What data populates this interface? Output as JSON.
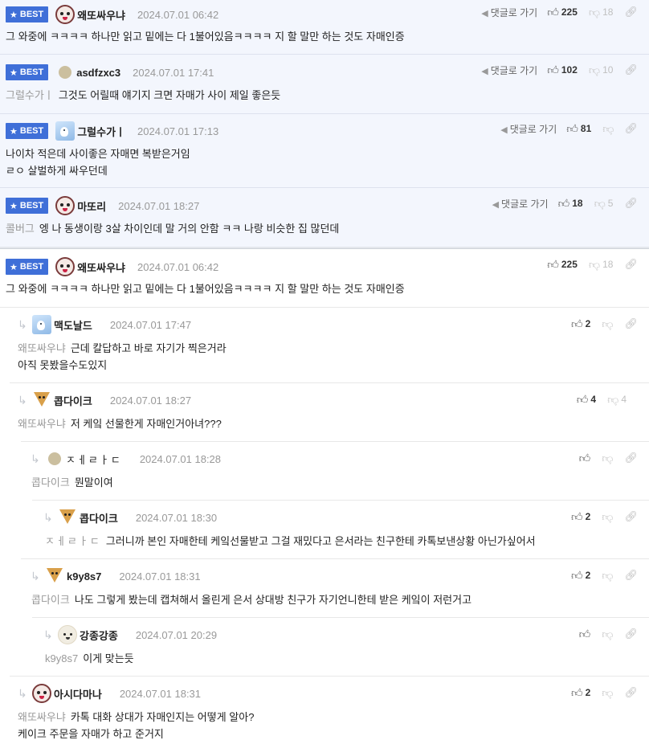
{
  "best_comments": [
    {
      "nick": "왜또싸우냐",
      "date": "2024.07.01 06:42",
      "goto": "댓글로 가기",
      "up": "225",
      "down": "18",
      "lines": [
        "그 와중에 ㅋㅋㅋㅋ 하나만 읽고 밑에는 다 1불어있음ㅋㅋㅋㅋ 지 할 말만 하는 것도 자매인증"
      ]
    },
    {
      "nick": "asdfzxc3",
      "date": "2024.07.01 17:41",
      "goto": "댓글로 가기",
      "up": "102",
      "down": "10",
      "mention": "그럴수가ㅣ",
      "lines": [
        "그것도 어릴때 얘기지 크면 자매가 사이 제일 좋은듯"
      ]
    },
    {
      "nick": "그럴수가ㅣ",
      "date": "2024.07.01 17:13",
      "goto": "댓글로 가기",
      "up": "81",
      "lines": [
        "나이차 적은데 사이좋은 자매면 복받은거임",
        "ㄹㅇ 살벌하게 싸우던데"
      ]
    },
    {
      "nick": "마또리",
      "date": "2024.07.01 18:27",
      "goto": "댓글로 가기",
      "up": "18",
      "down": "5",
      "mention": "콜버그",
      "lines": [
        "엥 나 동생이랑 3살 차이인데 말 거의 안함 ㅋㅋ 나랑 비슷한 집 많던데"
      ]
    }
  ],
  "best_label": "BEST",
  "thread_root": {
    "nick": "왜또싸우냐",
    "date": "2024.07.01 06:42",
    "up": "225",
    "down": "18",
    "lines": [
      "그 와중에 ㅋㅋㅋㅋ 하나만 읽고 밑에는 다 1불어있음ㅋㅋㅋㅋ 지 할 말만 하는 것도 자매인증"
    ]
  },
  "replies": [
    {
      "nick": "맥도날드",
      "date": "2024.07.01 17:47",
      "up": "2",
      "mention": "왜또싸우냐",
      "lines": [
        "근데 칼답하고 바로 자기가 찍은거라",
        "아직 못봤을수도있지"
      ]
    },
    {
      "nick": "콥다이크",
      "date": "2024.07.01 18:27",
      "up": "4",
      "down": "4",
      "mention": "왜또싸우냐",
      "lines": [
        "저 케잌 선물한게 자매인거아녀???"
      ]
    },
    {
      "nick": "ㅈㅔㄹㅏㄷ",
      "date": "2024.07.01 18:28",
      "mention": "콥다이크",
      "lines": [
        "뭔말이여"
      ]
    },
    {
      "nick": "콥다이크",
      "date": "2024.07.01 18:30",
      "up": "2",
      "mention": "ㅈㅔㄹㅏㄷ",
      "lines": [
        "그러니까 본인 자매한테 케잌선물받고 그걸 재밌다고 은서라는 친구한테 카톡보낸상황 아닌가싶어서"
      ]
    },
    {
      "nick": "k9y8s7",
      "date": "2024.07.01 18:31",
      "up": "2",
      "mention": "콥다이크",
      "lines": [
        "나도 그렇게 봤는데 캡쳐해서 올린게 은서 상대방 친구가 자기언니한테 받은 케잌이 저런거고"
      ]
    },
    {
      "nick": "강종강종",
      "date": "2024.07.01 20:29",
      "mention": "k9y8s7",
      "lines": [
        "이게 맞는듯"
      ]
    },
    {
      "nick": "아시다마나",
      "date": "2024.07.01 18:31",
      "up": "2",
      "mention": "왜또싸우냐",
      "lines": [
        "카톡 대화 상대가 자매인지는 어떻게 알아?",
        "케이크 주문을 자매가 하고 준거지"
      ]
    }
  ],
  "icons": {
    "up": "thumbs-up-icon",
    "down": "thumbs-down-icon",
    "link": "link-icon",
    "reply": "reply-arrow-icon",
    "goto": "arrow-icon",
    "star": "star-icon"
  },
  "colors": {
    "best_badge": "#3f6fd8",
    "best_bg": "#f3f6fd",
    "mention": "#999999",
    "date": "#999999"
  }
}
